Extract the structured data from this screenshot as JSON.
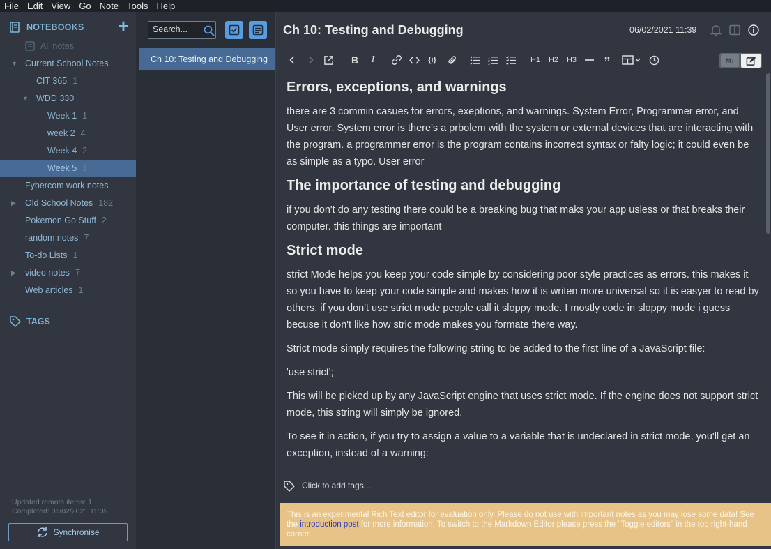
{
  "menu": [
    "File",
    "Edit",
    "View",
    "Go",
    "Note",
    "Tools",
    "Help"
  ],
  "sidebar": {
    "notebooks_label": "NOTEBOOKS",
    "add_icon": "plus-icon",
    "items": [
      {
        "label": "All notes",
        "count": "",
        "indent": 0,
        "arrow": "",
        "muted": true
      },
      {
        "label": "Current School Notes",
        "count": "",
        "indent": 0,
        "arrow": "down"
      },
      {
        "label": "CIT 365",
        "count": "1",
        "indent": 1,
        "arrow": ""
      },
      {
        "label": "WDD 330",
        "count": "",
        "indent": 1,
        "arrow": "down"
      },
      {
        "label": "Week 1",
        "count": "1",
        "indent": 2,
        "arrow": ""
      },
      {
        "label": "week 2",
        "count": "4",
        "indent": 2,
        "arrow": ""
      },
      {
        "label": "Week 4",
        "count": "2",
        "indent": 2,
        "arrow": ""
      },
      {
        "label": "Week 5",
        "count": "1",
        "indent": 2,
        "arrow": "",
        "selected": true
      },
      {
        "label": "Fybercom work notes",
        "count": "",
        "indent": 0,
        "arrow": ""
      },
      {
        "label": "Old School Notes",
        "count": "182",
        "indent": 0,
        "arrow": "right"
      },
      {
        "label": "Pokemon Go Stuff",
        "count": "2",
        "indent": 0,
        "arrow": ""
      },
      {
        "label": "random notes",
        "count": "7",
        "indent": 0,
        "arrow": ""
      },
      {
        "label": "To-do Lists",
        "count": "1",
        "indent": 0,
        "arrow": ""
      },
      {
        "label": "video notes",
        "count": "7",
        "indent": 0,
        "arrow": "right"
      },
      {
        "label": "Web articles",
        "count": "1",
        "indent": 0,
        "arrow": ""
      }
    ],
    "tags_label": "TAGS",
    "sync_status_line1": "Updated remote items: 1.",
    "sync_status_line2": "Completed: 06/02/2021 11:39",
    "sync_button": "Synchronise"
  },
  "notelist": {
    "search_placeholder": "Search...",
    "notes": [
      {
        "title": "Ch 10: Testing and Debugging",
        "selected": true
      }
    ]
  },
  "editor": {
    "title": "Ch 10: Testing and Debugging",
    "date": "06/02/2021 11:39",
    "toolbar_headings": [
      "H1",
      "H2",
      "H3"
    ],
    "toggle_md_label": "M↓",
    "content": {
      "h_errors": "Errors, exceptions, and warnings",
      "p_errors": "there are 3 commin casues for errors, exeptions, and warnings. System Error, Programmer error, and User error. System error is there's a prbolem with the system or external devices that are interacting with the program. a programmer error is the program contains incorrect syntax or falty logic; it could even be as simple as a typo. User error",
      "h_testing": "The importance of testing and debugging",
      "p_testing": "if you don't do any testing there could be a breaking bug that maks your app usless or that breaks their computer. this things are important",
      "h_strict": "Strict mode",
      "p_strict1": "strict Mode helps you keep your code simple by considering poor style practices as errors. this makes it so you have to keep your code simple and makes how it is writen more universal so it is easyer to read by  others. if you don't use strict mode people call it sloppy mode. I mostly code in sloppy mode i guess becuse it don't like how stric mode makes you formate there way.",
      "p_strict2": "Strict mode simply requires the following string to be added to the first line of a JavaScript file:",
      "p_strict3": "'use strict';",
      "p_strict4": "This will be picked up by any JavaScript engine that uses strict mode. If the engine does not support strict mode, this string will simply be ignored.",
      "p_strict5": "To see it in action, if you try to assign a value to a variable that is undeclared in strict mode, you'll get an exception, instead of a warning:"
    },
    "tags_prompt": "Click to add tags...",
    "banner": {
      "text1": "This is an experimental Rich Text editor for evaluation only. Please do not use with important notes as you may lose some data! See the ",
      "link": "introduction post",
      "text2": " for more information. To switch to the Markdown Editor please press the \"Toggle editors\" in the top right-hand corner."
    }
  },
  "colors": {
    "accent": "#7eb9d9",
    "selection": "#466a93",
    "button": "#5a9ce0",
    "banner": "#e8c388"
  }
}
